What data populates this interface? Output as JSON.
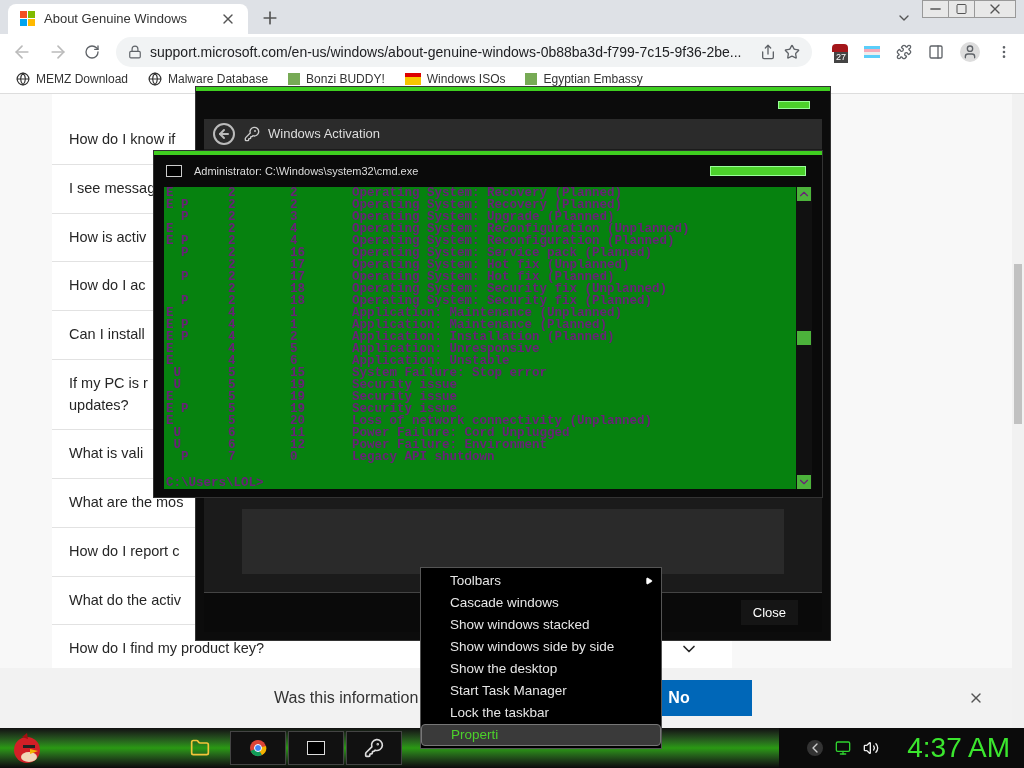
{
  "browser": {
    "tab": {
      "title": "About Genuine Windows"
    },
    "address": "support.microsoft.com/en-us/windows/about-genuine-windows-0b88ba3d-f799-7c15-9f36-2be...",
    "extension_badge": "27",
    "bookmarks": [
      {
        "label": "MEMZ Download"
      },
      {
        "label": "Malware Database"
      },
      {
        "label": "Bonzi BUDDY!"
      },
      {
        "label": "Windows ISOs"
      },
      {
        "label": "Egyptian Embassy"
      }
    ],
    "faq": [
      {
        "text": "How do I know if"
      },
      {
        "text": "I see messag"
      },
      {
        "text": "How is activ"
      },
      {
        "text": "How do I ac"
      },
      {
        "text": "Can I install"
      },
      {
        "text": "If my PC is r",
        "text_2": "updates?"
      },
      {
        "text": "What is vali"
      },
      {
        "text": "What are the mos"
      },
      {
        "text": "How do I report c"
      },
      {
        "text": "What do the activ"
      },
      {
        "text": "How do I find my product key?",
        "chevron": true
      }
    ],
    "feedback": {
      "question": "Was this information",
      "no": "No"
    }
  },
  "activation_window": {
    "title": "Windows Activation",
    "close": "Close"
  },
  "cmd": {
    "title": "Administrator: C:\\Windows\\system32\\cmd.exe",
    "rows": [
      {
        "flags": "E",
        "major": "2",
        "minor": "2",
        "reason": "Operating System: Recovery (Planned)"
      },
      {
        "flags": "E P",
        "major": "2",
        "minor": "2",
        "reason": "Operating System: Recovery (Planned)"
      },
      {
        "flags": "  P",
        "major": "2",
        "minor": "3",
        "reason": "Operating System: Upgrade (Planned)"
      },
      {
        "flags": "E",
        "major": "2",
        "minor": "4",
        "reason": "Operating System: Reconfiguration (Unplanned)"
      },
      {
        "flags": "E P",
        "major": "2",
        "minor": "4",
        "reason": "Operating System: Reconfiguration (Planned)"
      },
      {
        "flags": "  P",
        "major": "2",
        "minor": "16",
        "reason": "Operating System: Service pack (Planned)"
      },
      {
        "major": "2",
        "minor": "17",
        "reason": "Operating System: Hot fix (Unplanned)"
      },
      {
        "flags": "  P",
        "major": "2",
        "minor": "17",
        "reason": "Operating System: Hot fix (Planned)"
      },
      {
        "major": "2",
        "minor": "18",
        "reason": "Operating System: Security fix (Unplanned)"
      },
      {
        "flags": "  P",
        "major": "2",
        "minor": "18",
        "reason": "Operating System: Security fix (Planned)"
      },
      {
        "flags": "E",
        "major": "4",
        "minor": "1",
        "reason": "Application: Maintenance (Unplanned)"
      },
      {
        "flags": "E P",
        "major": "4",
        "minor": "1",
        "reason": "Application: Maintenance (Planned)"
      },
      {
        "flags": "E P",
        "major": "4",
        "minor": "2",
        "reason": "Application: Installation (Planned)"
      },
      {
        "flags": "E",
        "major": "4",
        "minor": "5",
        "reason": "Application: Unresponsive"
      },
      {
        "flags": "E",
        "major": "4",
        "minor": "6",
        "reason": "Application: Unstable"
      },
      {
        "flags": " U",
        "major": "5",
        "minor": "15",
        "reason": "System Failure: Stop error"
      },
      {
        "flags": " U",
        "major": "5",
        "minor": "19",
        "reason": "Security issue"
      },
      {
        "flags": "E",
        "major": "5",
        "minor": "19",
        "reason": "Security issue"
      },
      {
        "flags": "E P",
        "major": "5",
        "minor": "19",
        "reason": "Security issue"
      },
      {
        "flags": "E",
        "major": "5",
        "minor": "20",
        "reason": "Loss of network connectivity (Unplanned)"
      },
      {
        "flags": " U",
        "major": "6",
        "minor": "11",
        "reason": "Power Failure: Cord Unplugged"
      },
      {
        "flags": " U",
        "major": "6",
        "minor": "12",
        "reason": "Power Failure: Environment"
      },
      {
        "flags": "  P",
        "major": "7",
        "minor": "0",
        "reason": "Legacy API shutdown"
      }
    ],
    "prompt": "C:\\Users\\LOL>"
  },
  "context_menu": {
    "items": [
      {
        "label": "Toolbars",
        "kind": "submenu",
        "selected": false
      },
      {
        "label": "Cascade windows",
        "kind": "command",
        "selected": false
      },
      {
        "label": "Show windows stacked",
        "kind": "command",
        "selected": false
      },
      {
        "label": "Show windows side by side",
        "kind": "command",
        "selected": false
      },
      {
        "label": "Show the desktop",
        "kind": "command",
        "selected": false
      },
      {
        "label": "Start Task Manager",
        "kind": "command",
        "selected": false
      },
      {
        "label": "Lock the taskbar",
        "kind": "command",
        "selected": false
      },
      {
        "label": "Properti",
        "kind": "command",
        "selected": true
      }
    ]
  },
  "taskbar": {
    "clock": "4:37 AM"
  }
}
